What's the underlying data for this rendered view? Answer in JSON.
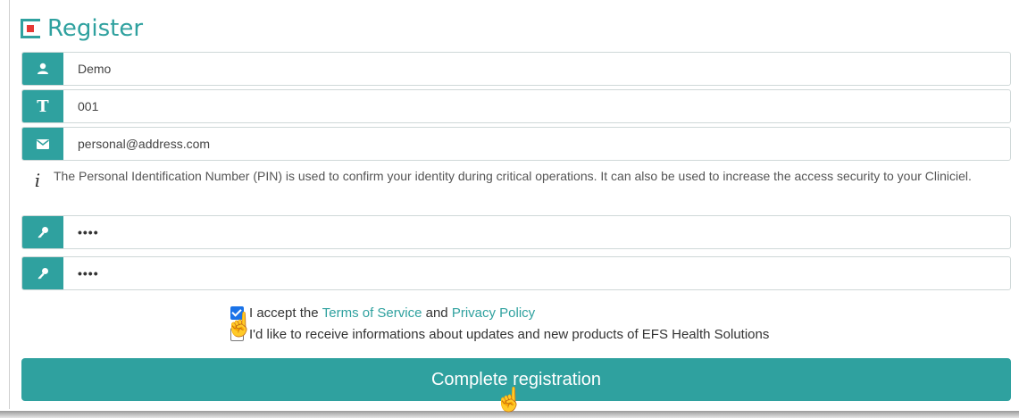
{
  "header": {
    "title": "Register"
  },
  "fields": [
    {
      "icon": "user-icon",
      "value": "Demo"
    },
    {
      "icon": "text-t-icon",
      "value": "001"
    },
    {
      "icon": "envelope-icon",
      "value": "personal@address.com"
    }
  ],
  "pin_info": {
    "icon": "info-icon",
    "text": "The Personal Identification Number (PIN) is used to confirm your identity during critical operations. It can also be used to increase the access security to your Cliniciel."
  },
  "pin_fields": [
    {
      "icon": "key-icon",
      "value": "••••"
    },
    {
      "icon": "key-icon",
      "value": "••••"
    }
  ],
  "consent": {
    "terms_prefix": "I accept the",
    "terms_link": "Terms of Service",
    "and": "and",
    "privacy_link": "Privacy Policy",
    "terms_checked": true,
    "newsletter_label": "I'd like to receive informations about updates and new products of EFS Health Solutions",
    "newsletter_checked": false
  },
  "submit_label": "Complete registration",
  "colors": {
    "accent": "#2fa19f",
    "logo_red": "#e53935"
  }
}
